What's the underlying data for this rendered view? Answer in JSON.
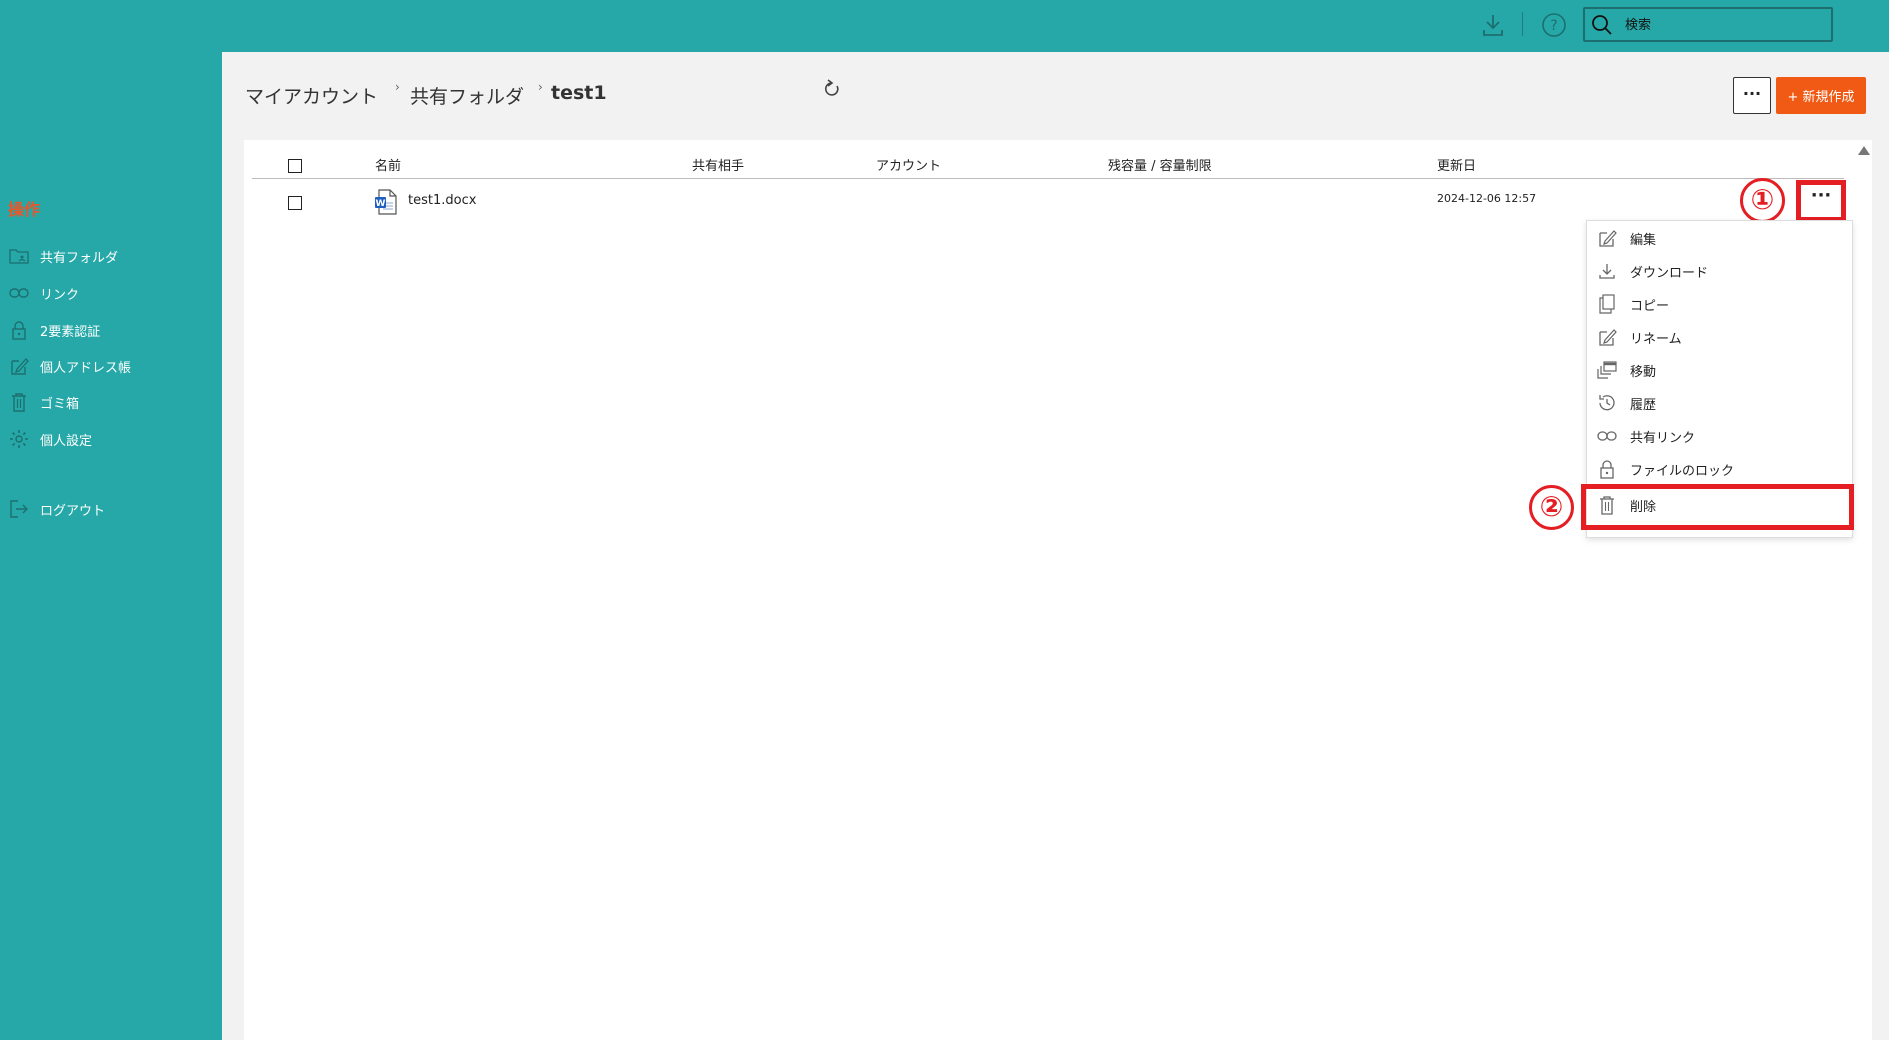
{
  "topbar": {
    "search_placeholder": "検索"
  },
  "sidebar": {
    "heading": "操作",
    "items": [
      {
        "label": "共有フォルダ"
      },
      {
        "label": "リンク"
      },
      {
        "label": "2要素認証"
      },
      {
        "label": "個人アドレス帳"
      },
      {
        "label": "ゴミ箱"
      },
      {
        "label": "個人設定"
      },
      {
        "label": "ログアウト"
      }
    ]
  },
  "breadcrumb": {
    "items": [
      "マイアカウント",
      "共有フォルダ",
      "test1"
    ]
  },
  "toolbar": {
    "more_label": "···",
    "new_label": "+ 新規作成"
  },
  "table": {
    "headers": [
      "名前",
      "共有相手",
      "アカウント",
      "残容量 / 容量制限",
      "更新日"
    ],
    "rows": [
      {
        "name": "test1.docx",
        "updated": "2024-12-06 12:57",
        "more": "···"
      }
    ]
  },
  "context_menu": {
    "items": [
      {
        "label": "編集"
      },
      {
        "label": "ダウンロード"
      },
      {
        "label": "コピー"
      },
      {
        "label": "リネーム"
      },
      {
        "label": "移動"
      },
      {
        "label": "履歴"
      },
      {
        "label": "共有リンク"
      },
      {
        "label": "ファイルのロック"
      },
      {
        "label": "削除"
      }
    ]
  },
  "annotations": {
    "step1": "①",
    "step2": "②",
    "color": "#e51e24"
  },
  "colors": {
    "teal": "#26a8a8",
    "accent_orange": "#f05a14",
    "heading_orange": "#e8562a"
  }
}
